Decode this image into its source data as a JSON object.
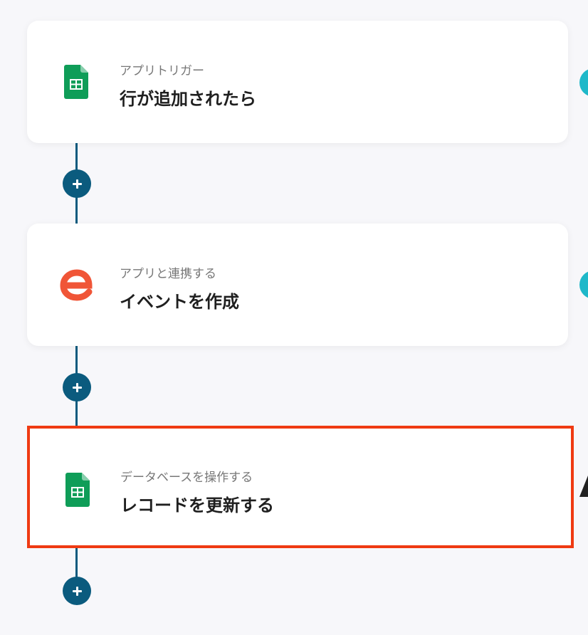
{
  "steps": [
    {
      "type_label": "アプリトリガー",
      "title": "行が追加されたら",
      "icon": "google-sheets-icon"
    },
    {
      "type_label": "アプリと連携する",
      "title": "イベントを作成",
      "icon": "eventbrite-icon"
    },
    {
      "type_label": "データベースを操作する",
      "title": "レコードを更新する",
      "icon": "google-sheets-icon"
    }
  ],
  "colors": {
    "connector": "#0b5b7e",
    "selected_border": "#ef3a12",
    "sheets_green": "#0f9d58",
    "eventbrite_orange": "#f05537",
    "status_teal": "#1fb8c9"
  }
}
